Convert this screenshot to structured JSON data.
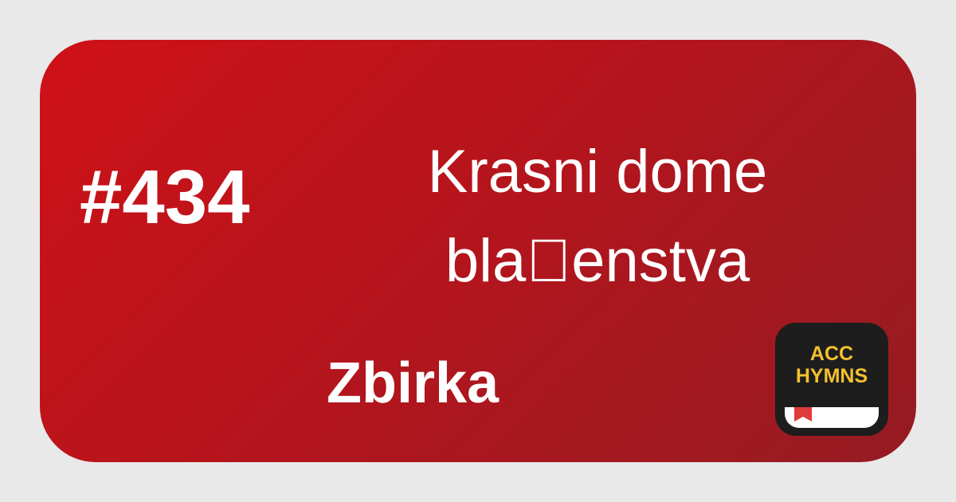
{
  "hymn": {
    "number": "#434",
    "title_line1": "Krasni dome",
    "title_line2": "bla\u0000enstva",
    "collection": "Zbirka"
  },
  "app_logo": {
    "line1": "ACC",
    "line2": "HYMNS",
    "icon": "book-bookmark-icon"
  },
  "colors": {
    "background": "#e9e9e9",
    "card_start": "#cf1117",
    "card_end": "#951b22",
    "text": "#ffffff",
    "logo_bg": "#1d1d1d",
    "logo_text": "#f2c12e",
    "bookmark": "#e03b3b"
  }
}
